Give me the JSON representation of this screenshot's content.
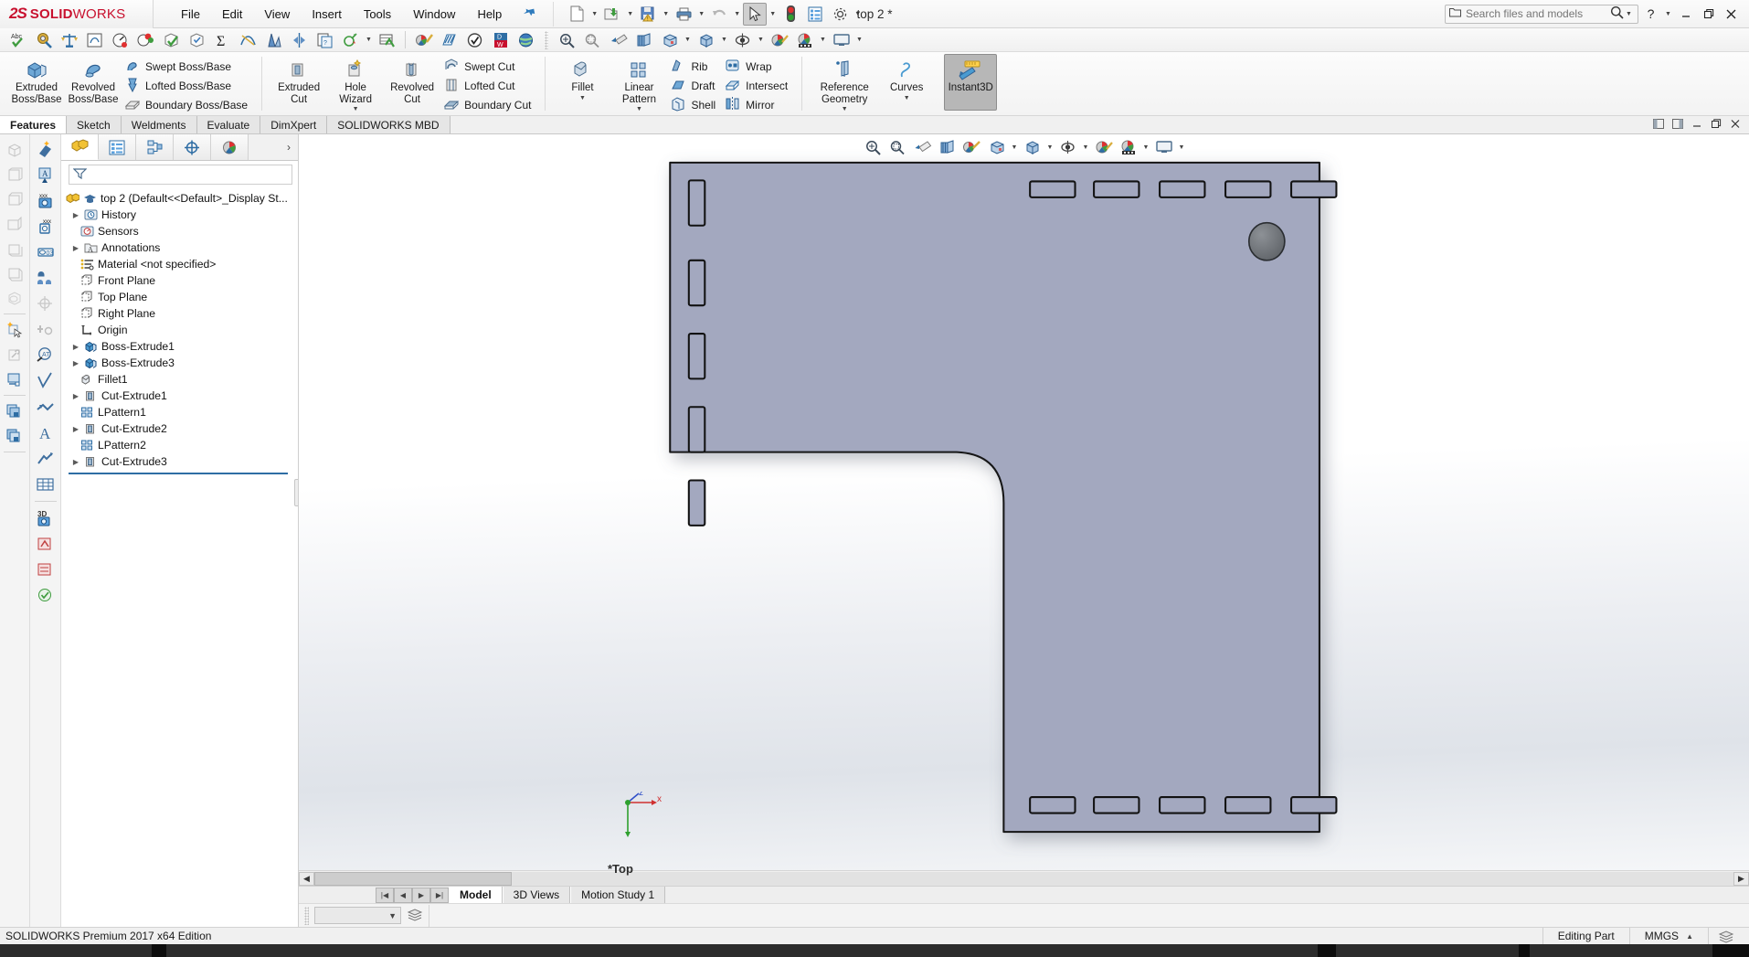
{
  "app": {
    "brand_mark": "2S",
    "brand_word1": "SOLID",
    "brand_word2": "WORKS",
    "document_title": "top 2 *",
    "edition": "SOLIDWORKS Premium 2017 x64 Edition"
  },
  "menu": {
    "items": [
      {
        "label": "File"
      },
      {
        "label": "Edit"
      },
      {
        "label": "View"
      },
      {
        "label": "Insert"
      },
      {
        "label": "Tools"
      },
      {
        "label": "Window"
      },
      {
        "label": "Help"
      }
    ],
    "pin_icon": "pushpin-icon"
  },
  "quick_access": {
    "buttons": [
      {
        "name": "new-document",
        "icon": "new-file-icon",
        "dropdown": true
      },
      {
        "name": "open-document",
        "icon": "open-folder-icon",
        "dropdown": true
      },
      {
        "name": "save-document",
        "icon": "save-disk-icon",
        "dropdown": true
      },
      {
        "name": "print-document",
        "icon": "printer-icon",
        "dropdown": true
      },
      {
        "name": "undo",
        "icon": "undo-arrow-icon",
        "dropdown": true
      },
      {
        "name": "select",
        "icon": "cursor-arrow-icon",
        "dropdown": true,
        "active": true
      },
      {
        "name": "rebuild",
        "icon": "traffic-light-icon",
        "dropdown": false
      },
      {
        "name": "file-properties",
        "icon": "properties-list-icon",
        "dropdown": false
      },
      {
        "name": "options",
        "icon": "gear-icon",
        "dropdown": true
      }
    ]
  },
  "search": {
    "placeholder": "Search files and models",
    "folder_icon": "folder-icon",
    "magnifier_icon": "magnifier-icon",
    "dropdown_caret": "chevron-down-icon"
  },
  "window_controls": {
    "help": "?",
    "help_caret": "chevron-down-icon",
    "minimize": "minimize-icon",
    "restore": "restore-icon",
    "close": "close-icon"
  },
  "cad_toolbar": {
    "groups": [
      {
        "name": "evaluate-tools",
        "buttons": [
          {
            "name": "spell-checker",
            "icon": "abc-check-icon"
          },
          {
            "name": "measure",
            "icon": "measure-icon"
          },
          {
            "name": "mass-properties",
            "icon": "scale-icon"
          },
          {
            "name": "section-properties",
            "icon": "section-properties-icon"
          },
          {
            "name": "performance-evaluation",
            "icon": "gauge-icon"
          },
          {
            "name": "simulation",
            "icon": "simulation-icon"
          },
          {
            "name": "check-geometry",
            "icon": "check-box-green-icon"
          },
          {
            "name": "geometry-analysis",
            "icon": "cube-check-icon"
          },
          {
            "name": "statistics",
            "icon": "sigma-icon"
          },
          {
            "name": "curvature",
            "icon": "curvature-icon"
          },
          {
            "name": "draft-analysis",
            "icon": "draft-analysis-icon"
          },
          {
            "name": "symmetry-check",
            "icon": "symmetry-check-icon"
          },
          {
            "name": "compare-documents",
            "icon": "compare-doc-icon"
          },
          {
            "name": "sensor",
            "icon": "sensor-icon",
            "dropdown": true
          },
          {
            "name": "deviation-analysis",
            "icon": "deviation-icon"
          }
        ]
      },
      {
        "name": "render-tools",
        "buttons": [
          {
            "name": "photoview-render",
            "icon": "render-brush-icon"
          },
          {
            "name": "zebra-stripes",
            "icon": "zebra-stripes-icon"
          },
          {
            "name": "verification",
            "icon": "check-circle-icon"
          },
          {
            "name": "design-checker",
            "icon": "dw-word-icon"
          },
          {
            "name": "sustainability",
            "icon": "globe-icon"
          }
        ]
      }
    ],
    "view_group": {
      "buttons": [
        {
          "name": "zoom-to-fit",
          "icon": "zoom-fit-icon"
        },
        {
          "name": "zoom-to-area",
          "icon": "zoom-area-icon"
        },
        {
          "name": "previous-view",
          "icon": "previous-view-icon"
        },
        {
          "name": "section-view",
          "icon": "section-view-icon"
        },
        {
          "name": "view-orientation",
          "icon": "view-orientation-icon"
        },
        {
          "name": "display-style",
          "icon": "display-style-icon",
          "dropdown": true
        },
        {
          "name": "hide-show-items",
          "icon": "hide-show-cube-icon",
          "dropdown": true
        },
        {
          "name": "edit-appearance",
          "icon": "appearance-eye-icon",
          "dropdown": true
        },
        {
          "name": "apply-scene",
          "icon": "scene-palette-icon"
        },
        {
          "name": "view-settings",
          "icon": "view-settings-icon",
          "dropdown": true
        },
        {
          "name": "viewport",
          "icon": "viewport-monitor-icon",
          "dropdown": true
        }
      ]
    }
  },
  "ribbon": {
    "groups": [
      {
        "name": "boss-base",
        "big_buttons": [
          {
            "name": "extruded-boss-base",
            "label_line1": "Extruded",
            "label_line2": "Boss/Base",
            "icon": "extruded-boss-icon"
          },
          {
            "name": "revolved-boss-base",
            "label_line1": "Revolved",
            "label_line2": "Boss/Base",
            "icon": "revolved-boss-icon"
          }
        ],
        "small_buttons": [
          {
            "name": "swept-boss-base",
            "label": "Swept Boss/Base",
            "icon": "swept-boss-icon"
          },
          {
            "name": "lofted-boss-base",
            "label": "Lofted Boss/Base",
            "icon": "lofted-boss-icon"
          },
          {
            "name": "boundary-boss-base",
            "label": "Boundary Boss/Base",
            "icon": "boundary-boss-icon"
          }
        ]
      },
      {
        "name": "cut",
        "big_buttons": [
          {
            "name": "extruded-cut",
            "label_line1": "Extruded",
            "label_line2": "Cut",
            "icon": "extruded-cut-icon"
          },
          {
            "name": "hole-wizard",
            "label_line1": "Hole",
            "label_line2": "Wizard",
            "icon": "hole-wizard-icon",
            "dropdown": true
          },
          {
            "name": "revolved-cut",
            "label_line1": "Revolved",
            "label_line2": "Cut",
            "icon": "revolved-cut-icon"
          }
        ],
        "small_buttons": [
          {
            "name": "swept-cut",
            "label": "Swept Cut",
            "icon": "swept-cut-icon"
          },
          {
            "name": "lofted-cut",
            "label": "Lofted Cut",
            "icon": "lofted-cut-icon"
          },
          {
            "name": "boundary-cut",
            "label": "Boundary Cut",
            "icon": "boundary-cut-icon"
          }
        ]
      },
      {
        "name": "features",
        "big_buttons": [
          {
            "name": "fillet",
            "label_line1": "Fillet",
            "label_line2": "",
            "icon": "fillet-icon",
            "dropdown": true
          },
          {
            "name": "linear-pattern",
            "label_line1": "Linear",
            "label_line2": "Pattern",
            "icon": "linear-pattern-icon",
            "dropdown": true
          }
        ],
        "small_columns": [
          [
            {
              "name": "rib",
              "label": "Rib",
              "icon": "rib-icon"
            },
            {
              "name": "draft",
              "label": "Draft",
              "icon": "draft-icon"
            },
            {
              "name": "shell",
              "label": "Shell",
              "icon": "shell-icon"
            }
          ],
          [
            {
              "name": "wrap",
              "label": "Wrap",
              "icon": "wrap-icon"
            },
            {
              "name": "intersect",
              "label": "Intersect",
              "icon": "intersect-icon"
            },
            {
              "name": "mirror",
              "label": "Mirror",
              "icon": "mirror-icon"
            }
          ]
        ]
      },
      {
        "name": "geometry",
        "big_buttons": [
          {
            "name": "reference-geometry",
            "label_line1": "Reference",
            "label_line2": "Geometry",
            "icon": "reference-geometry-icon",
            "dropdown": true
          },
          {
            "name": "curves",
            "label_line1": "Curves",
            "label_line2": "",
            "icon": "curves-icon",
            "dropdown": true
          }
        ]
      },
      {
        "name": "instant3d",
        "big_buttons": [
          {
            "name": "instant3d",
            "label_line1": "Instant3D",
            "label_line2": "",
            "icon": "instant3d-icon",
            "pressed": true
          }
        ]
      }
    ]
  },
  "ribbon_tabs": {
    "items": [
      {
        "label": "Features",
        "active": true
      },
      {
        "label": "Sketch",
        "active": false
      },
      {
        "label": "Weldments",
        "active": false
      },
      {
        "label": "Evaluate",
        "active": false
      },
      {
        "label": "DimXpert",
        "active": false
      },
      {
        "label": "SOLIDWORKS MBD",
        "active": false
      }
    ],
    "right_icons": [
      {
        "name": "panel-left-icon"
      },
      {
        "name": "panel-right-icon"
      },
      {
        "name": "minimize-doc-icon"
      },
      {
        "name": "restore-doc-icon"
      },
      {
        "name": "close-doc-icon"
      }
    ]
  },
  "feature_manager": {
    "tabs": [
      {
        "name": "feature-manager-tree",
        "icon": "yellow-feature-tree-icon",
        "active": true
      },
      {
        "name": "property-manager",
        "icon": "property-list-icon",
        "active": false
      },
      {
        "name": "configuration-manager",
        "icon": "configuration-icon",
        "active": false
      },
      {
        "name": "dimxpert-manager",
        "icon": "dimxpert-target-icon",
        "active": false
      },
      {
        "name": "display-manager",
        "icon": "display-sphere-icon",
        "active": false
      }
    ],
    "more_caret": "chevron-right-icon",
    "filter_icon": "filter-funnel-icon",
    "tree": [
      {
        "label": "top 2  (Default<<Default>_Display St...",
        "icon": "part-root-icon",
        "indent": 0,
        "arrow": false,
        "root": true
      },
      {
        "label": "History",
        "icon": "history-icon",
        "indent": 1,
        "arrow": true
      },
      {
        "label": "Sensors",
        "icon": "sensors-icon",
        "indent": 1,
        "arrow": false
      },
      {
        "label": "Annotations",
        "icon": "annotations-icon",
        "indent": 1,
        "arrow": true
      },
      {
        "label": "Material <not specified>",
        "icon": "material-icon",
        "indent": 1,
        "arrow": false
      },
      {
        "label": "Front Plane",
        "icon": "plane-icon",
        "indent": 1,
        "arrow": false
      },
      {
        "label": "Top Plane",
        "icon": "plane-icon",
        "indent": 1,
        "arrow": false
      },
      {
        "label": "Right Plane",
        "icon": "plane-icon",
        "indent": 1,
        "arrow": false
      },
      {
        "label": "Origin",
        "icon": "origin-icon",
        "indent": 1,
        "arrow": false
      },
      {
        "label": "Boss-Extrude1",
        "icon": "boss-extrude-icon",
        "indent": 1,
        "arrow": true
      },
      {
        "label": "Boss-Extrude3",
        "icon": "boss-extrude-icon",
        "indent": 1,
        "arrow": true
      },
      {
        "label": "Fillet1",
        "icon": "fillet-feature-icon",
        "indent": 1,
        "arrow": false
      },
      {
        "label": "Cut-Extrude1",
        "icon": "cut-extrude-icon",
        "indent": 1,
        "arrow": true
      },
      {
        "label": "LPattern1",
        "icon": "lpattern-icon",
        "indent": 1,
        "arrow": false
      },
      {
        "label": "Cut-Extrude2",
        "icon": "cut-extrude-icon",
        "indent": 1,
        "arrow": true
      },
      {
        "label": "LPattern2",
        "icon": "lpattern-icon",
        "indent": 1,
        "arrow": false
      },
      {
        "label": "Cut-Extrude3",
        "icon": "cut-extrude-icon",
        "indent": 1,
        "arrow": true
      }
    ]
  },
  "left_rail_1": {
    "buttons": [
      {
        "name": "view-isometric-ghost-icon"
      },
      {
        "name": "view-front-ghost-icon"
      },
      {
        "name": "view-top-ghost-icon"
      },
      {
        "name": "view-right-ghost-icon"
      },
      {
        "name": "view-back-ghost-icon"
      },
      {
        "name": "view-bottom-ghost-icon"
      },
      {
        "name": "view-trimetric-ghost-icon"
      },
      {
        "name": "sketch-new-icon"
      },
      {
        "name": "sketch-repair-icon"
      },
      {
        "name": "sketch-move-icon"
      },
      {
        "name": "layers-front-icon"
      },
      {
        "name": "layers-back-icon"
      }
    ]
  },
  "left_rail_2": {
    "buttons": [
      {
        "name": "smart-dimension-icon"
      },
      {
        "name": "note-a-icon"
      },
      {
        "name": "hole-callout-icon"
      },
      {
        "name": "datum-feature-icon"
      },
      {
        "name": "balloon-icon"
      },
      {
        "name": "auto-balloon-icon"
      },
      {
        "name": "center-mark-icon"
      },
      {
        "name": "centerline-icon"
      },
      {
        "name": "magnetic-line-icon"
      },
      {
        "name": "surface-finish-icon"
      },
      {
        "name": "weld-symbol-icon"
      },
      {
        "name": "text-a-icon"
      },
      {
        "name": "revision-cloud-icon"
      },
      {
        "name": "table-icon"
      },
      {
        "name": "3d-view-icon"
      },
      {
        "name": "dimxpert-auto-icon"
      },
      {
        "name": "dimxpert-tol-icon"
      },
      {
        "name": "dimxpert-status-icon"
      }
    ]
  },
  "graphics": {
    "view_label": "*Top",
    "origin_x_label": "x",
    "origin_z_label": "z",
    "model": {
      "face_color": "#a3a8bf",
      "edge_color": "#1a1a1a",
      "hole_color": "#6b6f74",
      "slot_count_left": 5,
      "slot_count_top": 5,
      "slot_count_bottom": 5,
      "hole_count": 1
    }
  },
  "bottom_tabs": {
    "nav_buttons": [
      "first-icon",
      "previous-icon",
      "next-icon",
      "last-icon"
    ],
    "tabs": [
      {
        "label": "Model",
        "active": true
      },
      {
        "label": "3D Views",
        "active": false
      },
      {
        "label": "Motion Study 1",
        "active": false
      }
    ]
  },
  "bottom_strip": {
    "combo_value": "",
    "combo_caret": "chevron-down-icon",
    "layers_icon": "layers-icon"
  },
  "status_bar": {
    "left_text": "SOLIDWORKS Premium 2017 x64 Edition",
    "editing_state": "Editing Part",
    "units": "MMGS",
    "units_caret": "chevron-up-icon",
    "overlay_icon": "stack-icon"
  },
  "colors": {
    "brand_red": "#c8102e",
    "accent_blue": "#2e6da4",
    "model_fill": "#a3a8bf",
    "selection_blue": "#2e6da4"
  }
}
